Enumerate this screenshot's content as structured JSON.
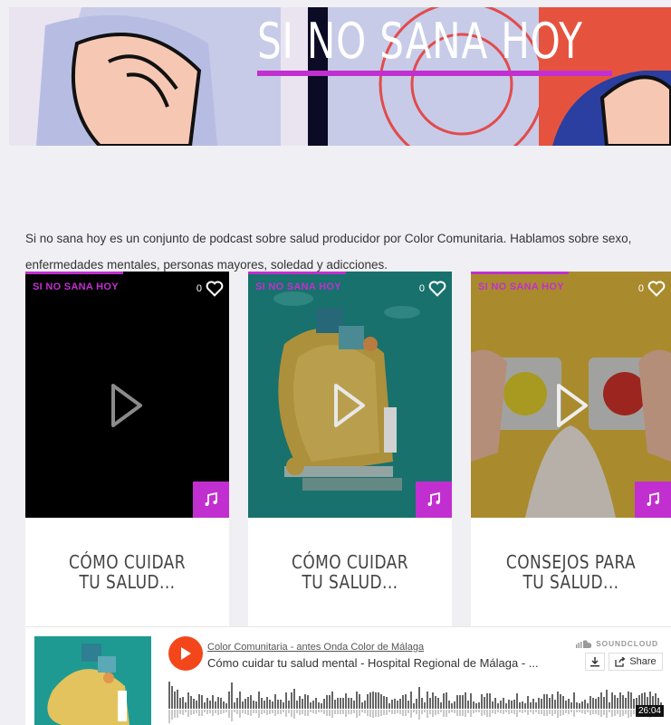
{
  "hero": {
    "title": "SI NO SANA HOY"
  },
  "description": "Si no sana hoy es un conjunto de podcast sobre salud producidor por Color Comunitaria. Hablamos sobre sexo, enfermedades mentales, personas mayores, soledad y adicciones.",
  "accent_color": "#c22fd0",
  "cards": [
    {
      "category": "SI NO SANA HOY",
      "likes": "0",
      "title_line1": "CÓMO CUIDAR",
      "title_line2": "TU SALUD..."
    },
    {
      "category": "SI NO SANA HOY",
      "likes": "0",
      "title_line1": "CÓMO CUIDAR",
      "title_line2": "TU SALUD..."
    },
    {
      "category": "SI NO SANA HOY",
      "likes": "0",
      "title_line1": "CONSEJOS PARA",
      "title_line2": "TU SALUD..."
    }
  ],
  "player": {
    "user": "Color Comunitaria - antes Onda Color de Málaga",
    "track": "Cómo cuidar tu salud mental - Hospital Regional de Málaga - ...",
    "brand": "SOUNDCLOUD",
    "share_label": "Share",
    "duration": "26:04"
  }
}
